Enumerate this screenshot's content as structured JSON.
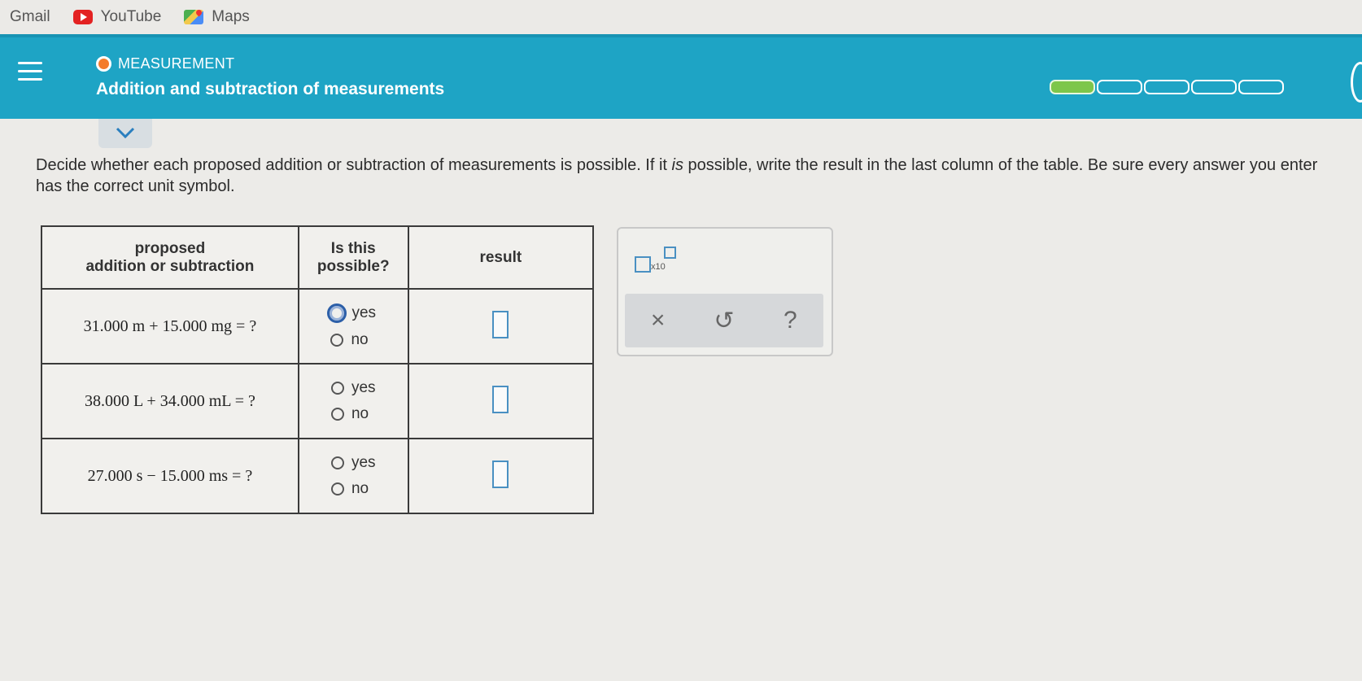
{
  "bookmarks": [
    {
      "label": "Gmail",
      "icon": "gmail-icon"
    },
    {
      "label": "YouTube",
      "icon": "youtube-icon"
    },
    {
      "label": "Maps",
      "icon": "maps-icon"
    }
  ],
  "header": {
    "topic": "MEASUREMENT",
    "title": "Addition and subtraction of measurements",
    "progress": {
      "segments": 5,
      "filled": 1
    },
    "accent": "#1ea4c5"
  },
  "instructions": {
    "before": "Decide whether each proposed addition or subtraction of measurements is possible. If it ",
    "emphasis": "is",
    "after": " possible, write the result in the last column of the table. Be sure every answer you enter has the correct unit symbol."
  },
  "table": {
    "headers": {
      "col1_line1": "proposed",
      "col1_line2": "addition or subtraction",
      "col2_line1": "Is this",
      "col2_line2": "possible?",
      "col3": "result"
    },
    "rows": [
      {
        "expression": "31.000 m + 15.000 mg = ?",
        "yes": "yes",
        "no": "no"
      },
      {
        "expression": "38.000 L + 34.000 mL = ?",
        "yes": "yes",
        "no": "no"
      },
      {
        "expression": "27.000 s − 15.000 ms = ?",
        "yes": "yes",
        "no": "no"
      }
    ]
  },
  "tools": {
    "x10_label": "x10",
    "clear": "×",
    "undo": "↺",
    "help": "?"
  }
}
